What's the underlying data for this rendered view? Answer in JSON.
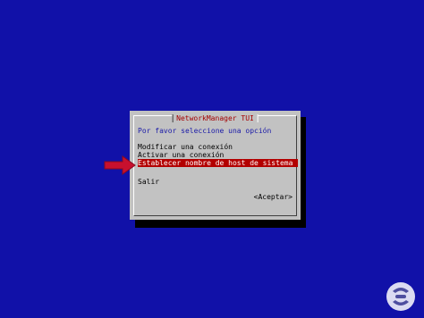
{
  "dialog": {
    "title": "NetworkManager TUI",
    "prompt": "Por favor seleccione una opción",
    "menu_items": [
      "Modificar una conexión",
      "Activar una conexión",
      "Establecer nombre de host de sistema"
    ],
    "selected_index": 2,
    "quit_label": "Salir",
    "accept_label": "<Aceptar>"
  },
  "icons": {
    "pointer": "right-arrow-icon",
    "watermark": "brand-logo"
  },
  "colors": {
    "background": "#1111a8",
    "dialog_bg": "#c2c2c2",
    "selected_bg": "#b30000",
    "title_text": "#a40000",
    "prompt_text": "#1a1aa8",
    "arrow": "#c8102e"
  }
}
